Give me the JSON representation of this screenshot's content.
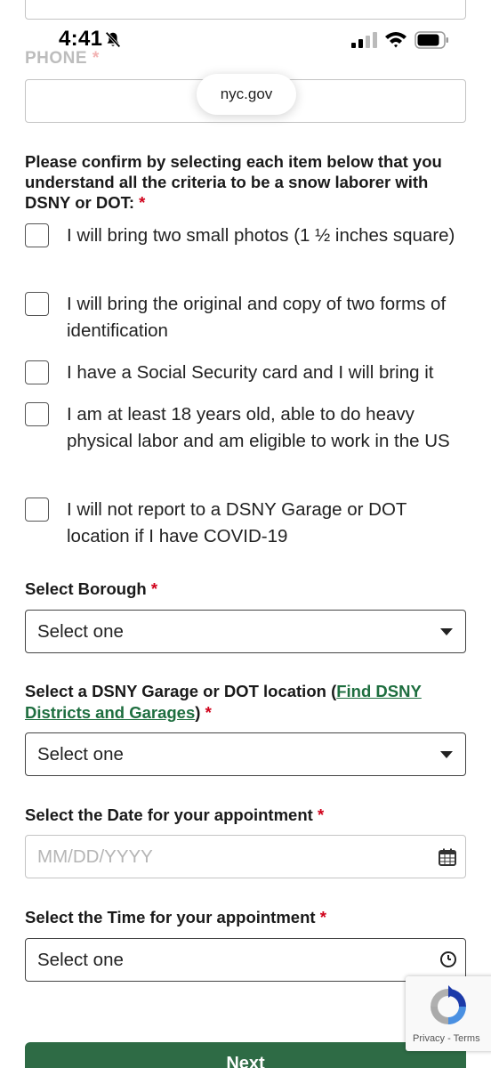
{
  "status_bar": {
    "time": "4:41"
  },
  "browser": {
    "url": "nyc.gov"
  },
  "phone": {
    "label": "PHONE",
    "required_mark": "*",
    "value": ""
  },
  "confirm": {
    "prompt": "Please confirm by selecting each item below that you understand all the criteria to be a snow laborer with DSNY or DOT:",
    "required_mark": "*",
    "items": [
      {
        "label": "I will bring two small photos (1 ½ inches square)",
        "checked": false
      },
      {
        "label": "I will bring the original and copy of two forms of identification",
        "checked": false
      },
      {
        "label": "I have a Social Security card and I will bring it",
        "checked": false
      },
      {
        "label": "I am at least 18 years old, able to do heavy physical labor and am eligible to work in the US",
        "checked": false
      },
      {
        "label": "I will not report to a DSNY Garage or DOT location if I have COVID-19",
        "checked": false
      }
    ]
  },
  "borough": {
    "label": "Select Borough",
    "required_mark": "*",
    "value": "Select one"
  },
  "location": {
    "label_prefix": "Select a DSNY Garage or DOT location (",
    "link_text": "Find DSNY Districts and Garages",
    "label_suffix": ")",
    "required_mark": "*",
    "value": "Select one"
  },
  "date": {
    "label": "Select the Date for your appointment",
    "required_mark": "*",
    "placeholder": "MM/DD/YYYY"
  },
  "time": {
    "label": "Select the Time for your appointment",
    "required_mark": "*",
    "value": "Select one"
  },
  "next_button": {
    "label": "Next"
  },
  "recaptcha": {
    "links": "Privacy - Terms"
  },
  "colors": {
    "accent_green": "#2e6b45",
    "link_green": "#1e6e3f",
    "required_red": "#d0021b"
  }
}
